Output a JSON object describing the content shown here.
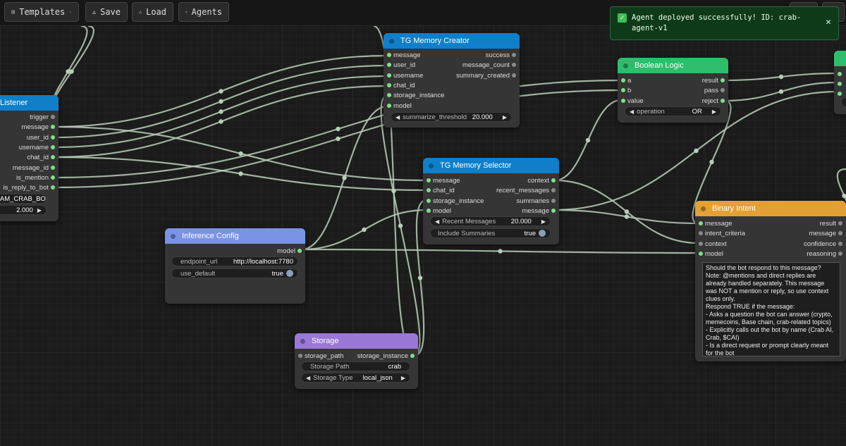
{
  "toolbar": {
    "templates_label": "Templates",
    "save_label": "Save",
    "load_label": "Load",
    "agents_label": "Agents"
  },
  "toast": {
    "message": "Agent deployed successfully! ID: crab-agent-v1",
    "status_color": "#3fbf55"
  },
  "colors": {
    "header_blue": "#0f7fc9",
    "header_green": "#2ebd6b",
    "header_orange": "#e3a034",
    "header_periwinkle": "#7a93e4",
    "header_purple": "#9a78d6",
    "wire": "#b8cdb8"
  },
  "nodes": {
    "listener": {
      "title": "Listener",
      "outputs": [
        "trigger",
        "message",
        "user_id",
        "username",
        "chat_id",
        "message_id",
        "is_mention",
        "is_reply_to_bot"
      ],
      "widget_text": "RAM_CRAB_BO",
      "widget_label": "l",
      "widget_value": "2.000"
    },
    "memory_creator": {
      "title": "TG Memory Creator",
      "inputs": [
        "message",
        "user_id",
        "username",
        "chat_id",
        "storage_instance",
        "model"
      ],
      "outputs": [
        "success",
        "message_count",
        "summary_created"
      ],
      "widget_label": "summarize_threshold",
      "widget_value": "20.000"
    },
    "memory_selector": {
      "title": "TG Memory Selector",
      "inputs": [
        "message",
        "chat_id",
        "storage_instance",
        "model"
      ],
      "outputs": [
        "context",
        "recent_messages",
        "summaries",
        "message"
      ],
      "widget1_label": "Recent Messages",
      "widget1_value": "20.000",
      "widget2_label": "Include Summaries",
      "widget2_value": "true"
    },
    "boolean_logic": {
      "title": "Boolean Logic",
      "inputs": [
        "a",
        "b",
        "value"
      ],
      "outputs": [
        "result",
        "pass",
        "reject"
      ],
      "widget_label": "operation",
      "widget_value": "OR"
    },
    "binary_intent": {
      "title": "Binary Intent",
      "inputs": [
        "message",
        "intent_criteria",
        "context",
        "model"
      ],
      "outputs": [
        "result",
        "message",
        "confidence",
        "reasoning"
      ],
      "prompt": "Should the bot respond to this message?\nNote: @mentions and direct replies are already handled separately. This message was NOT a mention or reply, so use context clues only.\nRespond TRUE if the message:\n- Asks a question the bot can answer (crypto, memecoins, Base chain, crab-related topics)\n- Explicitly calls out the bot by name (Crab AI, Crab, $CAI)\n- Is a direct request or prompt clearly meant for the bot\n- Raises a topic the bot has relevant context on\n..."
    },
    "inference_config": {
      "title": "Inference Config",
      "outputs": [
        "model"
      ],
      "widget1_label": "endpoint_url",
      "widget1_value": "http://localhost:7780",
      "widget2_label": "use_default",
      "widget2_value": "true"
    },
    "storage": {
      "title": "Storage",
      "inputs": [
        "storage_path"
      ],
      "outputs": [
        "storage_instance"
      ],
      "widget1_label": "Storage Path",
      "widget1_value": "crab",
      "widget2_label": "Storage Type",
      "widget2_value": "local_json"
    }
  }
}
